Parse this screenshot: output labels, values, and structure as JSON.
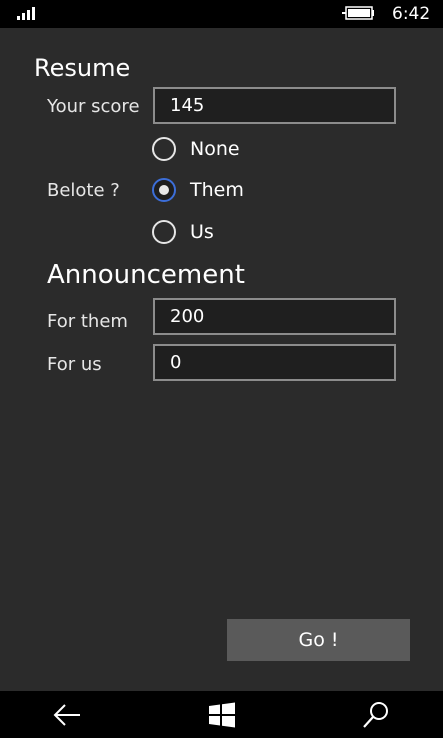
{
  "status_bar": {
    "time": "6:42",
    "signal_icon": "signal-bars-icon",
    "battery_icon": "battery-charging-icon"
  },
  "resume": {
    "title": "Resume",
    "score_label": "Your score",
    "score_value": "145",
    "belote_label": "Belote ?",
    "belote_options": [
      "None",
      "Them",
      "Us"
    ],
    "belote_selected": "Them"
  },
  "announcement": {
    "title": "Announcement",
    "for_them_label": "For them",
    "for_them_value": "200",
    "for_us_label": "For us",
    "for_us_value": "0"
  },
  "actions": {
    "go_label": "Go !"
  },
  "nav_bar": {
    "back_icon": "back-arrow-icon",
    "home_icon": "windows-logo-icon",
    "search_icon": "search-icon"
  },
  "colors": {
    "background": "#2b2b2b",
    "accent": "#3c6ed8",
    "button": "#5a5a5a"
  }
}
